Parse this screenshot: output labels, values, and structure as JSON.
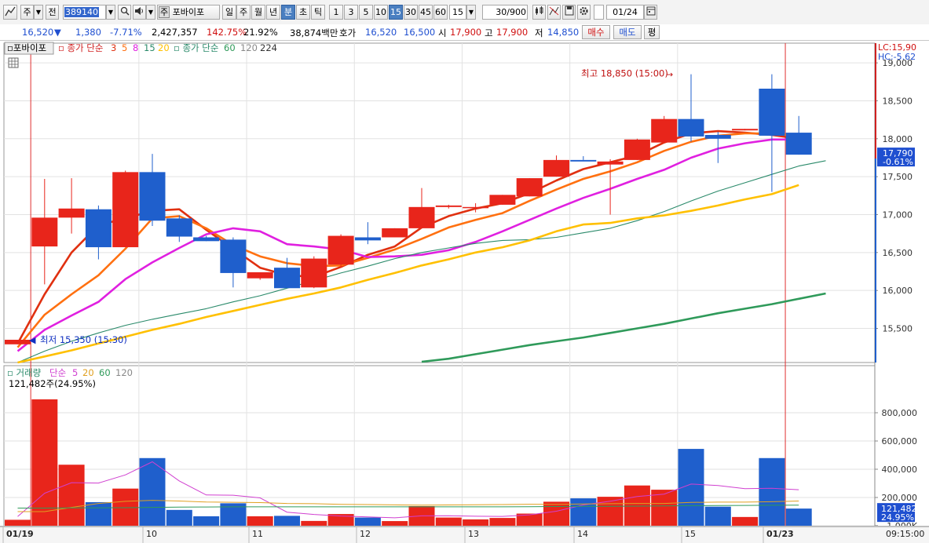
{
  "toolbar": {
    "market": "주",
    "prev_label": "전",
    "stock_code": "389140",
    "stock_name": "포바이포",
    "stock_badge": "주",
    "periods": [
      "일",
      "주",
      "월",
      "년",
      "분",
      "초",
      "틱"
    ],
    "selected_period": "분",
    "minutes": [
      "1",
      "3",
      "5",
      "10",
      "15",
      "30",
      "45",
      "60"
    ],
    "selected_minute": "15",
    "interval_value": "15",
    "count": "30",
    "count_max": "/900",
    "date": "01/24"
  },
  "quote": {
    "price": "16,520",
    "change": "1,380",
    "change_pct": "-7.71%",
    "volume": "2,427,357",
    "volume_ratio": "142.75%",
    "turnover": "21.92%",
    "amount": "38,874백만",
    "ask_label": "호가",
    "ask": "16,520",
    "bid": "16,500",
    "open_label": "시",
    "open": "17,900",
    "high_label": "고",
    "high": "17,900",
    "low_label": "저",
    "low": "14,850",
    "buy_label": "매수",
    "sell_label": "매도",
    "eval_label": "평"
  },
  "colors": {
    "up": "#e8251b",
    "down": "#1f5fcc",
    "ma3": "#e03010",
    "ma5": "#ff7010",
    "ma8": "#e020e0",
    "ma15": "#2a8a6a",
    "ma20": "#ffc000",
    "ma60": "#2f9a5a"
  },
  "chart_data": [
    {
      "type": "candlestick",
      "legend": {
        "name": "포바이포",
        "ma_label": "종가 단순",
        "ma_periods": [
          "3",
          "5",
          "8",
          "15",
          "20"
        ],
        "ma2_label": "종가 단순",
        "ma2_periods": [
          "60",
          "120",
          "224"
        ]
      },
      "x_labels": [
        "01/19",
        "10",
        "11",
        "12",
        "13",
        "14",
        "15",
        "01/23"
      ],
      "y_ticks": [
        "19,000",
        "18,500",
        "18,000",
        "17,500",
        "17,000",
        "16,500",
        "16,000",
        "15,500"
      ],
      "ylim": [
        15050,
        19260
      ],
      "lc_label": "LC:15,90",
      "hc_label": "HC:-5.62",
      "last_price_label": "17,790",
      "last_pct_label": "-0.61%",
      "max_label": "최고 18,850 (15:00)",
      "min_label": "최저 15,350 (15:30)",
      "candles": [
        {
          "o": 15290,
          "h": 15350,
          "l": 15290,
          "c": 15350
        },
        {
          "o": 16580,
          "h": 17470,
          "l": 16080,
          "c": 16960
        },
        {
          "o": 16960,
          "h": 17480,
          "l": 16750,
          "c": 17080
        },
        {
          "o": 17070,
          "h": 17120,
          "l": 16410,
          "c": 16570
        },
        {
          "o": 16570,
          "h": 17580,
          "l": 16570,
          "c": 17560
        },
        {
          "o": 17560,
          "h": 17800,
          "l": 16850,
          "c": 16920
        },
        {
          "o": 16950,
          "h": 16990,
          "l": 16640,
          "c": 16710
        },
        {
          "o": 16700,
          "h": 16720,
          "l": 16650,
          "c": 16650
        },
        {
          "o": 16670,
          "h": 16700,
          "l": 16040,
          "c": 16230
        },
        {
          "o": 16160,
          "h": 16240,
          "l": 16140,
          "c": 16240
        },
        {
          "o": 16300,
          "h": 16430,
          "l": 16040,
          "c": 16030
        },
        {
          "o": 16040,
          "h": 16450,
          "l": 16030,
          "c": 16420
        },
        {
          "o": 16340,
          "h": 16740,
          "l": 16300,
          "c": 16720
        },
        {
          "o": 16700,
          "h": 16900,
          "l": 16610,
          "c": 16660
        },
        {
          "o": 16700,
          "h": 16820,
          "l": 16700,
          "c": 16820
        },
        {
          "o": 16820,
          "h": 17350,
          "l": 16820,
          "c": 17100
        },
        {
          "o": 17100,
          "h": 17130,
          "l": 17080,
          "c": 17120
        },
        {
          "o": 17100,
          "h": 17150,
          "l": 17030,
          "c": 17100
        },
        {
          "o": 17130,
          "h": 17260,
          "l": 17130,
          "c": 17260
        },
        {
          "o": 17240,
          "h": 17480,
          "l": 17240,
          "c": 17480
        },
        {
          "o": 17500,
          "h": 17780,
          "l": 17500,
          "c": 17720
        },
        {
          "o": 17720,
          "h": 17770,
          "l": 17720,
          "c": 17700
        },
        {
          "o": 17660,
          "h": 17730,
          "l": 17000,
          "c": 17700
        },
        {
          "o": 17720,
          "h": 18000,
          "l": 17720,
          "c": 17990
        },
        {
          "o": 17950,
          "h": 18300,
          "l": 17950,
          "c": 18260
        },
        {
          "o": 18260,
          "h": 18850,
          "l": 17960,
          "c": 18030
        },
        {
          "o": 18050,
          "h": 18090,
          "l": 17680,
          "c": 18000
        },
        {
          "o": 18110,
          "h": 18130,
          "l": 18110,
          "c": 18130
        },
        {
          "o": 18660,
          "h": 18850,
          "l": 17300,
          "c": 18040
        },
        {
          "o": 18080,
          "h": 18300,
          "l": 17790,
          "c": 17790
        }
      ],
      "ma": [
        {
          "name": "3",
          "color": "#e03010",
          "width": 2.6,
          "values": [
            15300,
            15950,
            16500,
            16860,
            16950,
            17050,
            17070,
            16800,
            16550,
            16300,
            16200,
            16180,
            16310,
            16470,
            16580,
            16830,
            16980,
            17080,
            17150,
            17280,
            17450,
            17600,
            17690,
            17780,
            17950,
            18070,
            18100,
            18080,
            18050,
            18000
          ]
        },
        {
          "name": "5",
          "color": "#ff7010",
          "width": 2.6,
          "values": [
            15250,
            15680,
            15950,
            16200,
            16550,
            16950,
            16980,
            16820,
            16600,
            16450,
            16360,
            16320,
            16330,
            16430,
            16540,
            16680,
            16830,
            16930,
            17020,
            17180,
            17330,
            17470,
            17570,
            17690,
            17840,
            17960,
            18040,
            18070,
            18070,
            18040
          ]
        },
        {
          "name": "8",
          "color": "#e020e0",
          "width": 2.6,
          "values": [
            15200,
            15480,
            15670,
            15850,
            16150,
            16370,
            16560,
            16740,
            16820,
            16780,
            16610,
            16580,
            16540,
            16440,
            16450,
            16470,
            16530,
            16640,
            16780,
            16930,
            17080,
            17220,
            17340,
            17470,
            17590,
            17750,
            17870,
            17940,
            17990,
            17990
          ]
        },
        {
          "name": "15",
          "color": "#2a8a6a",
          "width": 1.1,
          "values": [
            15050,
            15200,
            15330,
            15440,
            15540,
            15620,
            15690,
            15760,
            15850,
            15930,
            16030,
            16130,
            16230,
            16320,
            16420,
            16500,
            16560,
            16620,
            16660,
            16670,
            16700,
            16760,
            16820,
            16920,
            17040,
            17180,
            17310,
            17420,
            17530,
            17640,
            17710
          ]
        },
        {
          "name": "20",
          "color": "#ffc000",
          "width": 2.6,
          "values": [
            15050,
            15130,
            15210,
            15300,
            15390,
            15480,
            15560,
            15650,
            15730,
            15810,
            15890,
            15960,
            16040,
            16140,
            16230,
            16330,
            16410,
            16500,
            16570,
            16660,
            16780,
            16870,
            16890,
            16950,
            16990,
            17050,
            17120,
            17200,
            17270,
            17390
          ]
        },
        {
          "name": "60",
          "color": "#2f9a5a",
          "width": 2.6,
          "values": [
            null,
            null,
            null,
            null,
            null,
            null,
            null,
            null,
            null,
            null,
            null,
            null,
            null,
            null,
            null,
            15060,
            15100,
            15160,
            15220,
            15280,
            15330,
            15380,
            15440,
            15500,
            15560,
            15630,
            15700,
            15760,
            15820,
            15890,
            15960
          ]
        }
      ]
    },
    {
      "type": "bar",
      "legend": {
        "name": "거래량",
        "ma_label": "단순",
        "ma_periods": [
          "5",
          "20",
          "60",
          "120"
        ]
      },
      "info_label": "121,482주(24.95%)",
      "y_ticks": [
        "1,000K",
        "800,000",
        "600,000",
        "400,000",
        "200,000"
      ],
      "ylim": [
        0,
        1000000
      ],
      "last_value_label": "121,482",
      "last_pct_label": "24.95%",
      "values": [
        42000,
        895000,
        432000,
        167000,
        263000,
        479000,
        112000,
        67000,
        159000,
        67000,
        70000,
        34000,
        83000,
        58000,
        33000,
        139000,
        58000,
        45000,
        55000,
        86000,
        170000,
        194000,
        205000,
        285000,
        255000,
        544000,
        135000,
        62000,
        479000,
        121482
      ],
      "ma5": [
        65000,
        230000,
        305000,
        302000,
        360000,
        453000,
        317000,
        218000,
        216000,
        197000,
        96000,
        80000,
        69000,
        63000,
        56000,
        70000,
        71000,
        67000,
        66000,
        77000,
        103000,
        147000,
        174000,
        207000,
        224000,
        295000,
        285000,
        263000,
        265000,
        255000
      ],
      "ma20": [
        100000,
        100000,
        130000,
        158000,
        173000,
        180000,
        175000,
        168000,
        166000,
        164000,
        158000,
        156000,
        151000,
        150000,
        148000,
        146000,
        147000,
        149000,
        150000,
        152000,
        151000,
        154000,
        156000,
        158000,
        158000,
        165000,
        167000,
        167000,
        170000,
        175000
      ],
      "ma60": [
        125000,
        125000,
        126000,
        127000,
        128000,
        130000,
        132000,
        133000,
        134000,
        134000,
        134000,
        134000,
        134000,
        134000,
        134000,
        134000,
        134000,
        134000,
        134000,
        135000,
        136000,
        137000,
        138000,
        139000,
        140000,
        142000,
        143000,
        144000,
        145000,
        146000
      ]
    }
  ],
  "time_label": "09:15:00"
}
